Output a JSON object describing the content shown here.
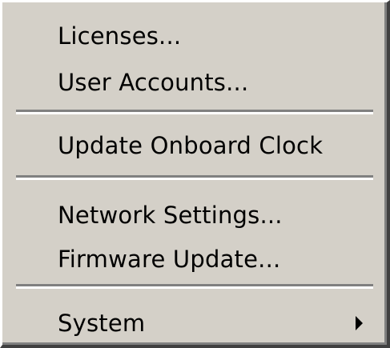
{
  "menu": {
    "items": [
      {
        "label": "Licenses..."
      },
      {
        "label": "User Accounts..."
      },
      {
        "label": "Update Onboard Clock"
      },
      {
        "label": "Network Settings..."
      },
      {
        "label": "Firmware Update..."
      },
      {
        "label": "System",
        "has_submenu": true
      }
    ]
  },
  "icons": {
    "submenu": "chevron-right-icon"
  },
  "colors": {
    "menu_background": "#d4d0c8",
    "separator_shadow": "#808080",
    "separator_highlight": "#ffffff",
    "text": "#000000"
  }
}
